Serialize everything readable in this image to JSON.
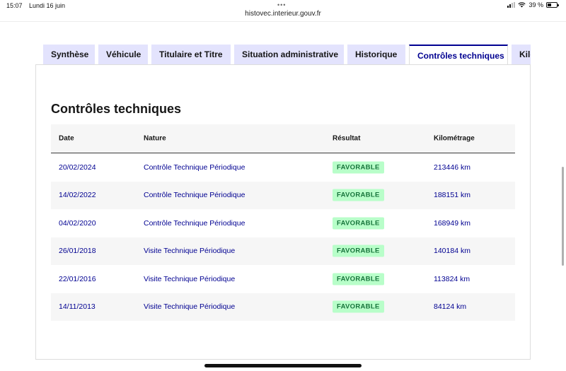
{
  "status_bar": {
    "time": "15:07",
    "date": "Lundi 16 juin",
    "battery": "39 %",
    "battery_level": 0.39
  },
  "browser": {
    "url": "histovec.interieur.gouv.fr"
  },
  "tabs": [
    {
      "label": "Synthèse",
      "active": false
    },
    {
      "label": "Véhicule",
      "active": false
    },
    {
      "label": "Titulaire et Titre",
      "active": false
    },
    {
      "label": "Situation administrative",
      "active": false
    },
    {
      "label": "Historique",
      "active": false
    },
    {
      "label": "Contrôles techniques",
      "active": true
    },
    {
      "label": "Kilo",
      "active": false
    }
  ],
  "panel": {
    "title": "Contrôles techniques",
    "columns": {
      "date": "Date",
      "nature": "Nature",
      "result": "Résultat",
      "km": "Kilométrage"
    },
    "rows": [
      {
        "date": "20/02/2024",
        "nature": "Contrôle Technique Périodique",
        "result": "FAVORABLE",
        "km": "213446 km"
      },
      {
        "date": "14/02/2022",
        "nature": "Contrôle Technique Périodique",
        "result": "FAVORABLE",
        "km": "188151 km"
      },
      {
        "date": "04/02/2020",
        "nature": "Contrôle Technique Périodique",
        "result": "FAVORABLE",
        "km": "168949 km"
      },
      {
        "date": "26/01/2018",
        "nature": "Visite Technique Périodique",
        "result": "FAVORABLE",
        "km": "140184 km"
      },
      {
        "date": "22/01/2016",
        "nature": "Visite Technique Périodique",
        "result": "FAVORABLE",
        "km": "113824 km"
      },
      {
        "date": "14/11/2013",
        "nature": "Visite Technique Périodique",
        "result": "FAVORABLE",
        "km": "84124 km"
      }
    ]
  },
  "colors": {
    "primary": "#000091",
    "tab_bg": "#e3e3fd",
    "badge_bg": "#b8fec9",
    "badge_text": "#18753c"
  }
}
